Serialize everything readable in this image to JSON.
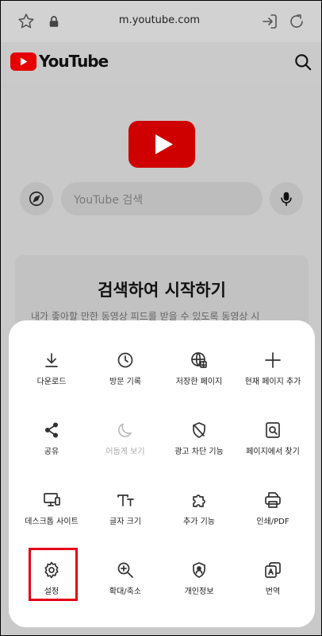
{
  "browser": {
    "url": "m.youtube.com"
  },
  "youtube": {
    "brand": "YouTube",
    "search_placeholder": "YouTube 검색",
    "card_title": "검색하여 시작하기",
    "card_subtitle": "내가 좋아할 만한 동영상 피드를 받을 수 있도록 동영상 시"
  },
  "menu": {
    "items": [
      {
        "label": "다운로드",
        "icon": "download-icon"
      },
      {
        "label": "방문 기록",
        "icon": "history-icon"
      },
      {
        "label": "저장한 페이지",
        "icon": "saved-page-icon"
      },
      {
        "label": "현재 페이지 추가",
        "icon": "plus-icon"
      },
      {
        "label": "공유",
        "icon": "share-icon"
      },
      {
        "label": "어둡게 보기",
        "icon": "moon-icon"
      },
      {
        "label": "광고 차단 기능",
        "icon": "ad-block-icon"
      },
      {
        "label": "페이지에서 찾기",
        "icon": "find-in-page-icon"
      },
      {
        "label": "데스크톱 사이트",
        "icon": "desktop-icon"
      },
      {
        "label": "글자 크기",
        "icon": "text-size-icon"
      },
      {
        "label": "추가 기능",
        "icon": "puzzle-icon"
      },
      {
        "label": "인쇄/PDF",
        "icon": "print-icon"
      },
      {
        "label": "설정",
        "icon": "gear-icon"
      },
      {
        "label": "확대/축소",
        "icon": "zoom-icon"
      },
      {
        "label": "개인정보",
        "icon": "privacy-icon"
      },
      {
        "label": "번역",
        "icon": "translate-icon"
      }
    ]
  },
  "colors": {
    "youtube_red": "#e60000",
    "highlight_red": "#e5001b"
  }
}
